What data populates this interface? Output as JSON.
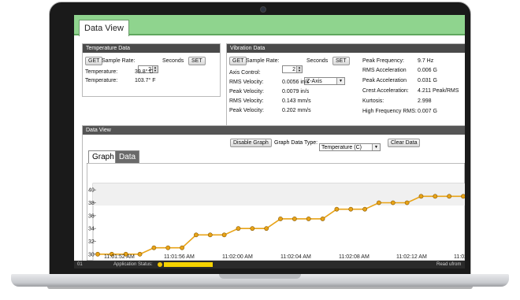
{
  "tabs": {
    "data_view": "Data View"
  },
  "temperature": {
    "title": "Temperature Data",
    "get_label": "GET",
    "sample_rate_label": "Sample Rate:",
    "sample_rate_value": "2",
    "seconds_label": "Seconds",
    "set_label": "SET",
    "row1_label": "Temperature:",
    "row1_value": "39.8° C",
    "row2_label": "Temperature:",
    "row2_value": "103.7° F"
  },
  "vibration": {
    "title": "Vibration Data",
    "get_label": "GET",
    "sample_rate_label": "Sample Rate:",
    "sample_rate_value": "2",
    "seconds_label": "Seconds",
    "set_label": "SET",
    "axis_label": "Axis Control:",
    "axis_value": "Z-Axis",
    "rows": [
      {
        "label": "RMS Velocity:",
        "value": "0.0056 in/s"
      },
      {
        "label": "Peak Velocity:",
        "value": "0.0079 in/s"
      },
      {
        "label": "RMS Velocity:",
        "value": "0.143 mm/s"
      },
      {
        "label": "Peak Velocity:",
        "value": "0.202 mm/s"
      }
    ],
    "right_rows": [
      {
        "label": "Peak Frequency:",
        "value": "9.7 Hz"
      },
      {
        "label": "RMS Acceleration",
        "value": "0.006 G"
      },
      {
        "label": "Peak Acceleration",
        "value": "0.031 G"
      },
      {
        "label": "Crest Acceleration:",
        "value": "4.211 Peak/RMS"
      },
      {
        "label": "Kurtosis:",
        "value": "2.998"
      },
      {
        "label": "High Frequency RMS:",
        "value": "0.007 G"
      }
    ]
  },
  "dataview": {
    "title": "Data View",
    "disable_graph": "Disable Graph",
    "graph_type_label": "Graph Data Type:",
    "graph_type_value": "Temperature (C)",
    "clear_data": "Clear Data",
    "tab_graph": "Graph",
    "tab_data": "Data"
  },
  "status": {
    "left": "01",
    "app_status_label": "Application Status:",
    "right": "Read ufrom"
  },
  "chart_data": {
    "type": "line",
    "series": [
      {
        "values": [
          30,
          30,
          30,
          30,
          31,
          31,
          31,
          33,
          33,
          33,
          34,
          34,
          34,
          35.5,
          35.5,
          35.5,
          35.5,
          37,
          37,
          37,
          38,
          38,
          38,
          39,
          39,
          39,
          39
        ]
      }
    ],
    "x_ticks": [
      "11:01:52 AM",
      "11:01:56 AM",
      "11:02:00 AM",
      "11:02:04 AM",
      "11:02:08 AM",
      "11:02:12 AM",
      "11:02:1"
    ],
    "y_ticks": [
      30,
      32,
      34,
      36,
      38,
      40
    ],
    "ylim": [
      29,
      41
    ],
    "grid": false,
    "colors": {
      "line": "#e8a317",
      "marker": "#e8a317",
      "marker_edge": "#8a5a00"
    }
  }
}
